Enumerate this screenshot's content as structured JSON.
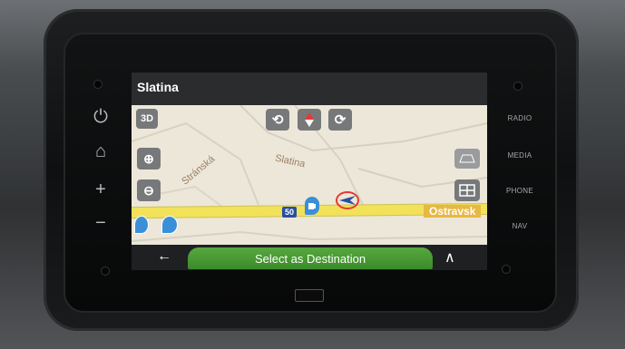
{
  "app": {
    "title": "Slatina"
  },
  "map": {
    "view_mode": "3D",
    "labels": {
      "street": "Stránská",
      "district": "Slatina",
      "road_number": "50",
      "highway": "Ostravsk"
    },
    "controls": {
      "rotate_left": "rotate-left-icon",
      "compass": "compass-icon",
      "rotate_right": "rotate-right-icon",
      "zoom_in": "zoom-in-icon",
      "zoom_out": "zoom-out-icon",
      "tilt": "tilt-view-icon",
      "layers": "grid-view-icon"
    }
  },
  "bottom": {
    "select_label": "Select as Destination",
    "back": "←",
    "expand": "∧"
  },
  "hardware": {
    "left": [
      "⏻",
      "⌂",
      "+",
      "−"
    ],
    "right": [
      "RADIO",
      "MEDIA",
      "PHONE",
      "NAV"
    ]
  },
  "colors": {
    "accent_green": "#4b9b35",
    "road_yellow": "#f1e25a",
    "title_bg": "#2b2c2d"
  }
}
